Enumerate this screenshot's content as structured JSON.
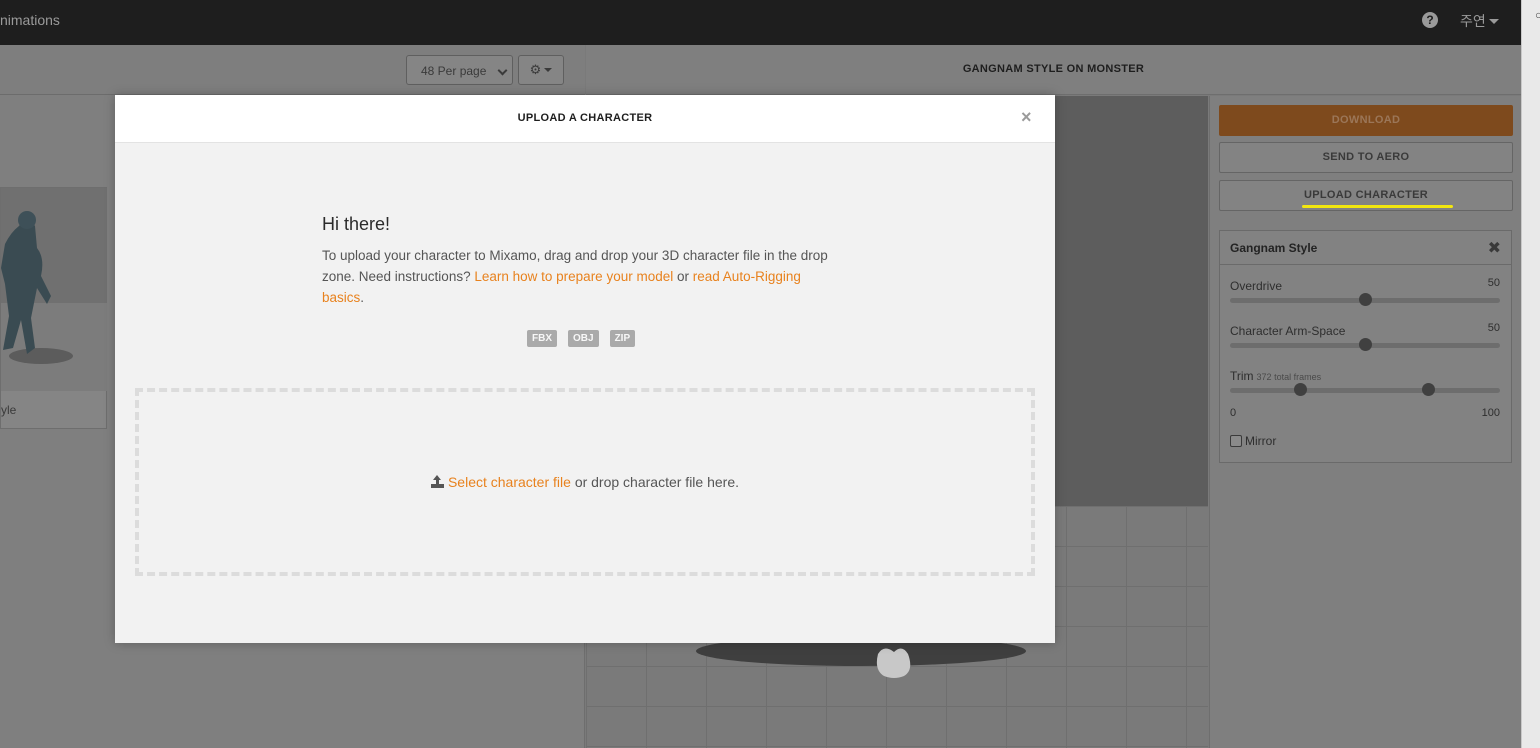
{
  "topbar": {
    "nav_text": "nimations",
    "help_icon": "?",
    "user_name": "주연"
  },
  "library": {
    "per_page_label": "48 Per page",
    "gear_icon": "⚙",
    "card_label": "yle"
  },
  "viewer": {
    "title": "GANGNAM STYLE ON MONSTER"
  },
  "settings": {
    "download_label": "DOWNLOAD",
    "send_aero_label": "SEND TO AERO",
    "upload_label": "UPLOAD CHARACTER",
    "panel_title": "Gangnam Style",
    "close_icon": "✖",
    "overdrive_label": "Overdrive",
    "overdrive_value": "50",
    "armspace_label": "Character Arm-Space",
    "armspace_value": "50",
    "trim_label": "Trim",
    "trim_sub": "372 total frames",
    "trim_min": "0",
    "trim_max": "100",
    "mirror_label": "Mirror"
  },
  "modal": {
    "title": "UPLOAD A CHARACTER",
    "close_icon": "×",
    "greeting": "Hi there!",
    "intro_text": "To upload your character to Mixamo, drag and drop your 3D character file in the drop zone. Need instructions?",
    "link_prepare": "Learn how to prepare your model",
    "or_text": "or",
    "link_autorig": "read Auto-Rigging basics",
    "period": ".",
    "formats": [
      "FBX",
      "OBJ",
      "ZIP"
    ],
    "select_link": "Select character file",
    "drop_suffix": "or drop character file here."
  },
  "colors": {
    "accent": "#e8821e",
    "download_bg": "#7e4a1d",
    "highlight": "#f2e70f"
  }
}
